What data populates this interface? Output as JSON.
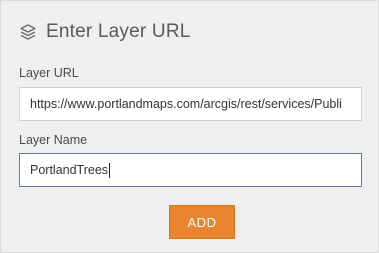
{
  "header": {
    "title": "Enter Layer URL",
    "icon": "layers-icon"
  },
  "layer_url": {
    "label": "Layer URL",
    "value": "https://www.portlandmaps.com/arcgis/rest/services/Publi"
  },
  "layer_name": {
    "label": "Layer Name",
    "value": "PortlandTrees"
  },
  "add_button": {
    "label": "ADD"
  },
  "colors": {
    "panel_background": "#efefef",
    "accent": "#e8852d",
    "focus_border": "#5b7fa6"
  }
}
